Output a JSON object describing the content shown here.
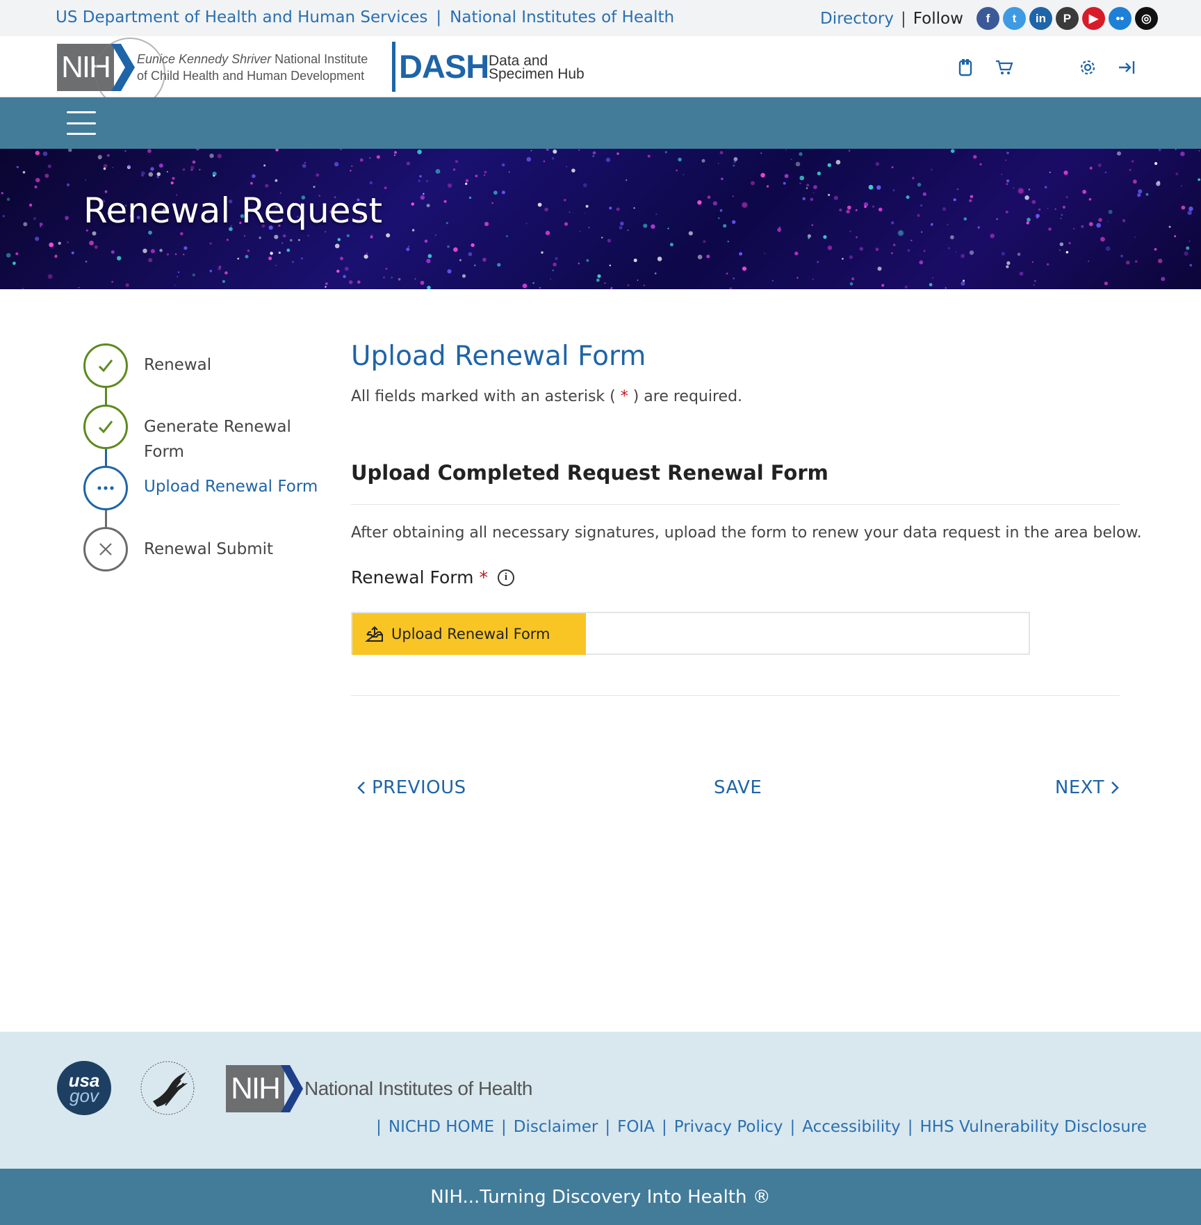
{
  "utility": {
    "hhs_link": "US Department of Health and Human Services",
    "nih_link": "National Institutes of Health",
    "separator": "|",
    "directory": "Directory",
    "follow": "Follow",
    "social": [
      {
        "name": "facebook-icon",
        "glyph": "f",
        "color": "#3b5998"
      },
      {
        "name": "twitter-icon",
        "glyph": "t",
        "color": "#3e9be3"
      },
      {
        "name": "linkedin-icon",
        "glyph": "in",
        "color": "#1e64a8"
      },
      {
        "name": "pinterest-icon",
        "glyph": "P",
        "color": "#3a3a3a"
      },
      {
        "name": "youtube-icon",
        "glyph": "▶",
        "color": "#d71b28"
      },
      {
        "name": "flickr-icon",
        "glyph": "••",
        "color": "#1e7fd6"
      },
      {
        "name": "instagram-icon",
        "glyph": "◎",
        "color": "#111111"
      }
    ]
  },
  "header": {
    "nih_logo": "NIH",
    "nichd_line1_italic": "Eunice Kennedy Shriver",
    "nichd_line1_rest": " National Institute",
    "nichd_line2": "of Child Health and Human Development",
    "dash_logo": "DASH",
    "dash_sub_line1": "Data and",
    "dash_sub_line2": "Specimen Hub",
    "icons": [
      "bookmark-icon",
      "cart-icon",
      "settings-icon",
      "login-icon"
    ]
  },
  "hero": {
    "title": "Renewal Request"
  },
  "stepper": {
    "steps": [
      {
        "label_line1": "Renewal",
        "label_line2": "",
        "status": "complete"
      },
      {
        "label_line1": "Generate Renewal",
        "label_line2": "Form",
        "status": "complete"
      },
      {
        "label_line1": "Upload Renewal Form",
        "label_line2": "",
        "status": "current"
      },
      {
        "label_line1": "Renewal Submit",
        "label_line2": "",
        "status": "incomplete"
      }
    ],
    "colors": {
      "complete": "#5d8a1e",
      "current": "#1e64a8",
      "incomplete": "#6b6b6b"
    }
  },
  "main": {
    "title": "Upload Renewal Form",
    "required_note_prefix": "All fields marked with an asterisk ( ",
    "required_asterisk": "*",
    "required_note_suffix": " ) are required.",
    "section_title": "Upload Completed Request Renewal Form",
    "instructions": "After obtaining all necessary signatures, upload the form to renew your data request in the area below.",
    "field_label": "Renewal Form",
    "field_asterisk": "*",
    "info_glyph": "i",
    "upload_button": "Upload Renewal Form",
    "upload_value": ""
  },
  "nav": {
    "previous": "PREVIOUS",
    "save": "SAVE",
    "next": "NEXT"
  },
  "footer": {
    "usa_line1": "usa",
    "usa_line2": "gov",
    "nih_logo": "NIH",
    "nih_text": "National Institutes of Health",
    "links": [
      "NICHD HOME",
      "Disclaimer",
      "FOIA",
      "Privacy Policy",
      "Accessibility",
      "HHS Vulnerability Disclosure"
    ],
    "separator": "|",
    "tagline": "NIH...Turning Discovery Into Health ®"
  },
  "colors": {
    "accent_blue": "#1e64a8",
    "nav_teal": "#437c99",
    "upload_yellow": "#f9c525",
    "required_red": "#c0171d",
    "footer_bg": "#d9e8ef"
  }
}
